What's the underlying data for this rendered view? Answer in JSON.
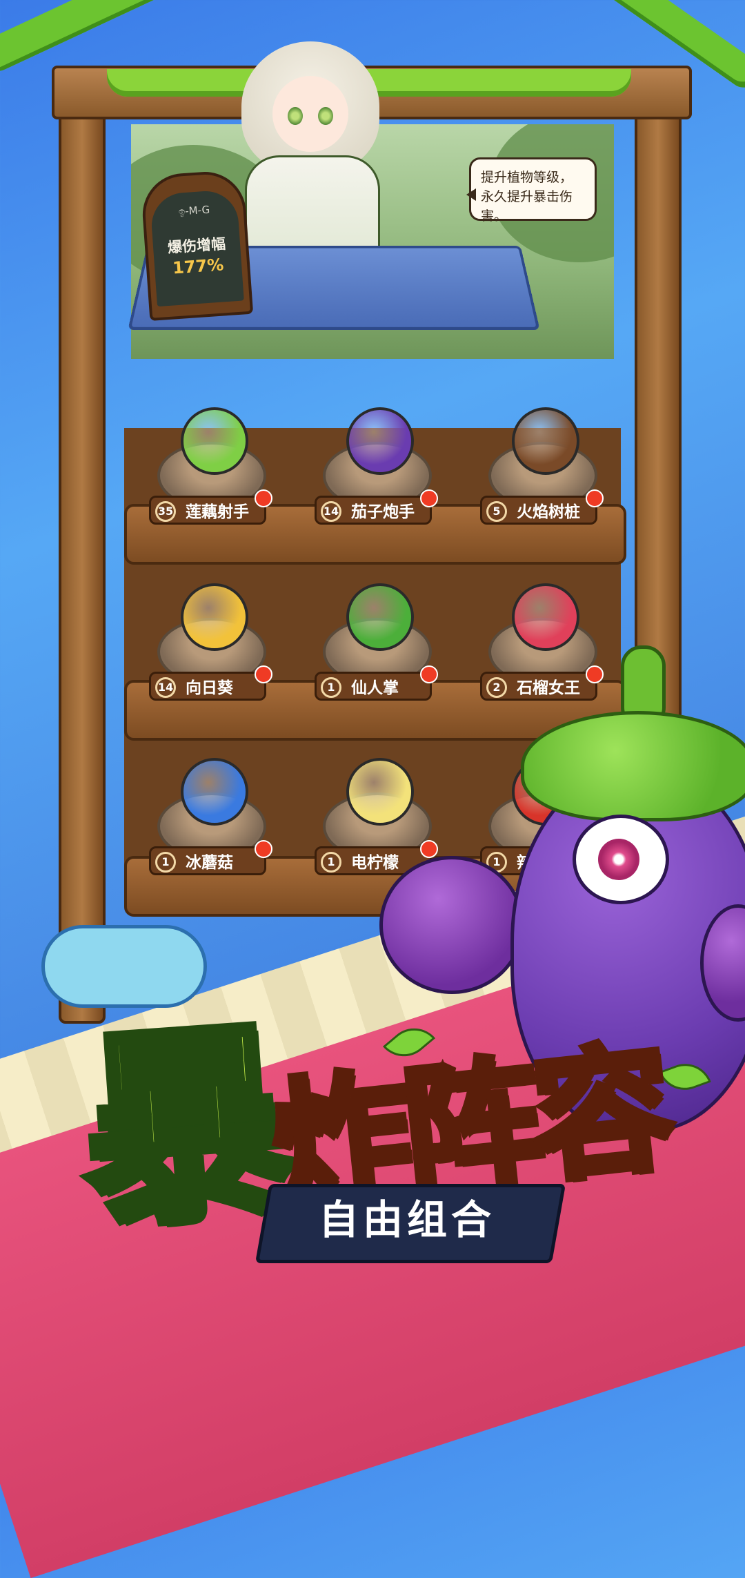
{
  "shop": {
    "board_title": "爆伤增幅",
    "board_value": "177%",
    "board_scribble": "ඉ-M-G",
    "speech": "提升植物等级，永久提升暴击伤害。"
  },
  "plants": [
    {
      "level": "35",
      "name": "莲藕射手",
      "color": "#7fcf45"
    },
    {
      "level": "14",
      "name": "茄子炮手",
      "color": "#6a3cb0"
    },
    {
      "level": "5",
      "name": "火焰树桩",
      "color": "#7a4a28"
    },
    {
      "level": "14",
      "name": "向日葵",
      "color": "#f2c23a"
    },
    {
      "level": "1",
      "name": "仙人掌",
      "color": "#4caf3a"
    },
    {
      "level": "2",
      "name": "石榴女王",
      "color": "#e0405a"
    },
    {
      "level": "1",
      "name": "冰蘑菇",
      "color": "#3a7ae0"
    },
    {
      "level": "1",
      "name": "电柠檬",
      "color": "#f3e27a"
    },
    {
      "level": "1",
      "name": "辣椒",
      "color": "#d8342a"
    }
  ],
  "banner": {
    "title_big": "暴",
    "title_rest": "炸阵容",
    "subtitle": "自由组合"
  }
}
